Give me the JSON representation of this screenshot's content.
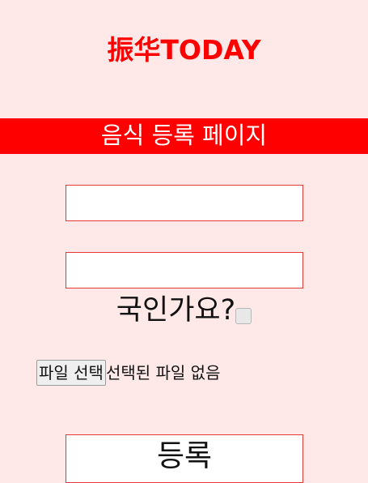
{
  "header": {
    "brand": "振华TODAY",
    "banner": "음식 등록 페이지"
  },
  "form": {
    "field1": {
      "value": "",
      "placeholder": ""
    },
    "field2": {
      "value": "",
      "placeholder": ""
    },
    "domestic_label": "국인가요?",
    "domestic_checked": false,
    "file_button_label": "파일 선택",
    "file_status": "선택된 파일 없음",
    "submit_label": "등록"
  },
  "colors": {
    "background": "#ffe8e8",
    "accent": "#ff0000",
    "input_border": "#e53935"
  }
}
